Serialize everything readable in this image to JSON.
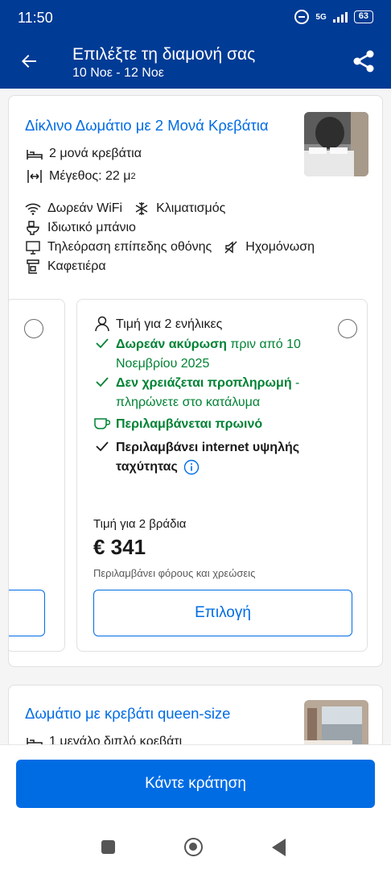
{
  "status_bar": {
    "time": "11:50",
    "network": "5G",
    "battery": "63"
  },
  "header": {
    "title": "Επιλέξτε τη διαμονή σας",
    "dates": "10 Νοε - 12 Νοε"
  },
  "room1": {
    "title": "Δίκλινο Δωμάτιο με 2 Μονά Κρεβάτια",
    "beds": "2 μονά κρεβάτια",
    "size_prefix": "Μέγεθος: 22 μ",
    "size_sup": "2",
    "amenities": {
      "wifi": "Δωρεάν WiFi",
      "ac": "Κλιματισμός",
      "bathroom": "Ιδιωτικό μπάνιο",
      "tv": "Τηλεόραση επίπεδης οθόνης",
      "soundproof": "Ηχομόνωση",
      "coffee": "Καφετιέρα"
    },
    "rate": {
      "guests": "Τιμή για 2 ενήλικες",
      "cancel_bold": "Δωρεάν ακύρωση",
      "cancel_rest": " πριν από 10 Νοεμβρίου 2025",
      "prepay_bold": "Δεν χρειάζεται προπληρωμή",
      "prepay_rest": " - πληρώνετε στο κατάλυμα",
      "breakfast": "Περιλαμβάνεται πρωινό",
      "internet": "Περιλαμβάνει internet υψηλής ταχύτητας",
      "price_label": "Τιμή για 2 βράδια",
      "price": "€ 341",
      "price_note": "Περιλαμβάνει φόρους και χρεώσεις",
      "select_label": "Επιλογή"
    }
  },
  "room2": {
    "title": "Δωμάτιο με κρεβάτι queen-size",
    "beds": "1 μεγάλο διπλό κρεβάτι"
  },
  "book_button": "Κάντε κράτηση",
  "colors": {
    "brand_dark": "#003b95",
    "accent": "#006ce4",
    "green": "#008234"
  }
}
